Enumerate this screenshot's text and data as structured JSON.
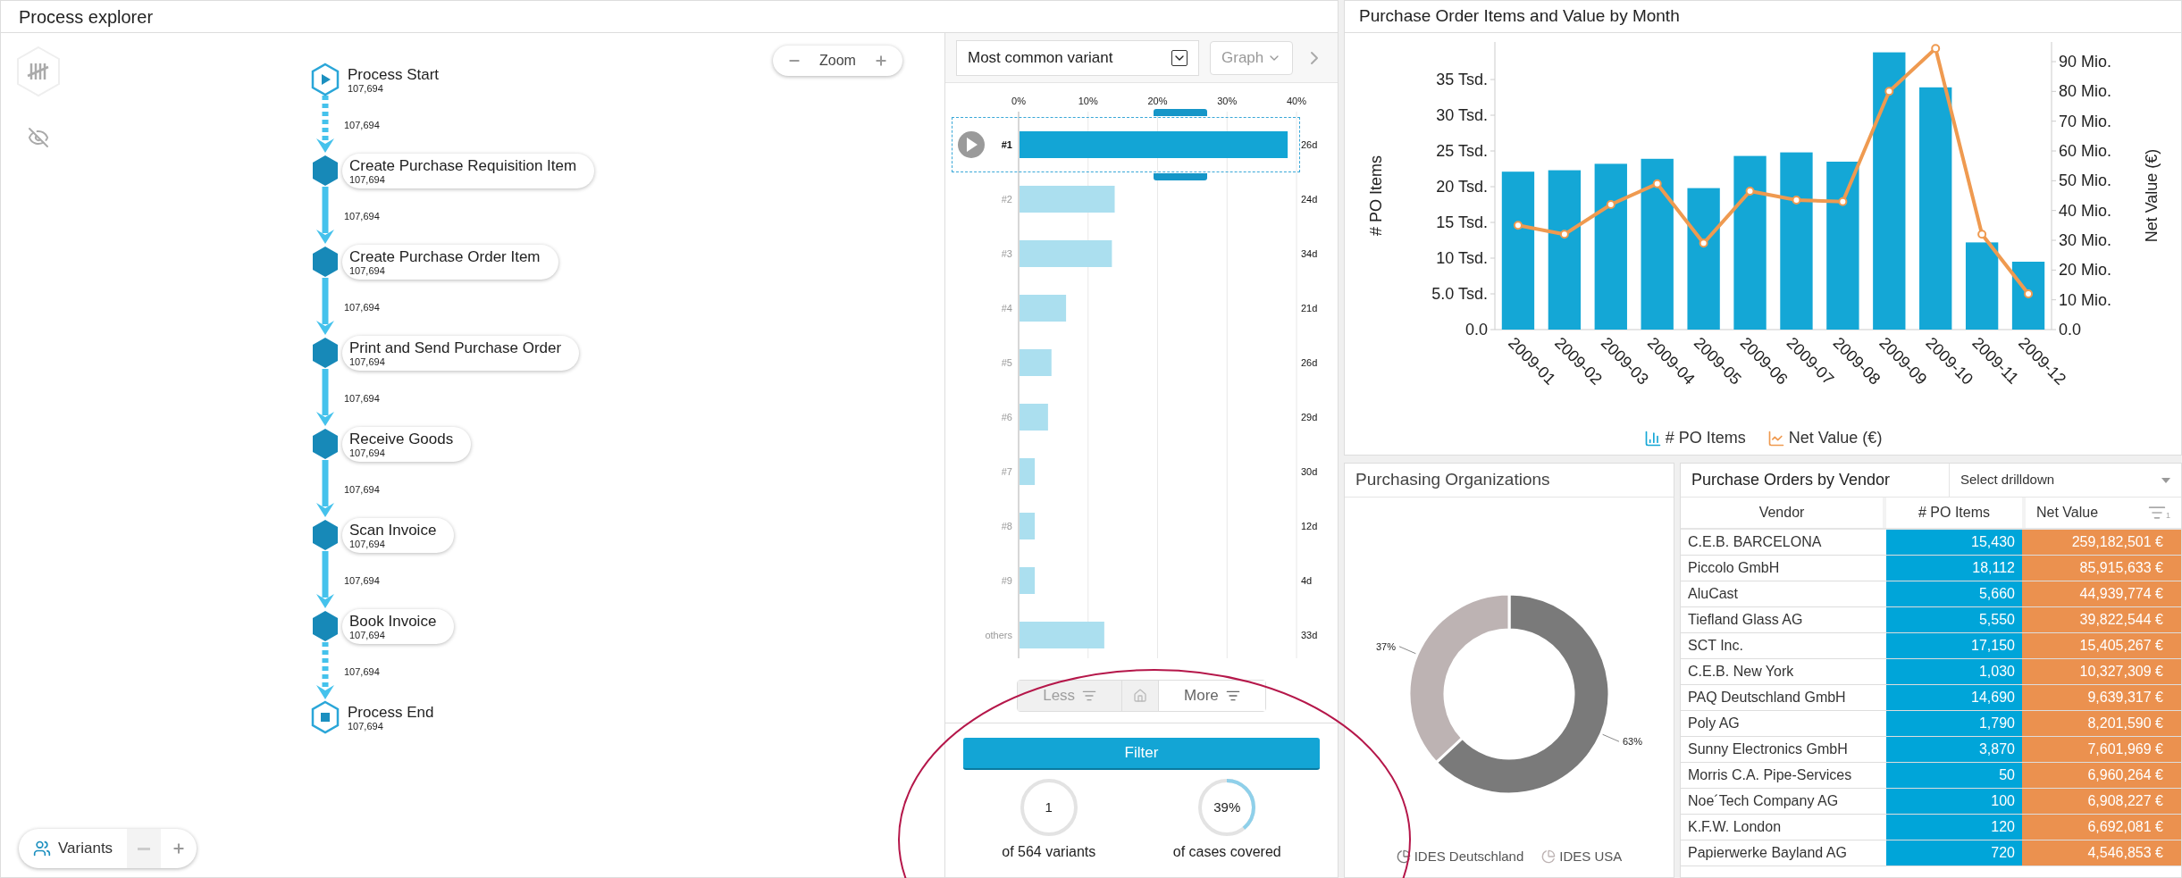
{
  "process_explorer": {
    "title": "Process explorer",
    "zoom": {
      "label": "Zoom"
    },
    "variants_control": {
      "label": "Variants"
    },
    "nodes": [
      {
        "kind": "start",
        "label": "Process Start",
        "count": "107,694"
      },
      {
        "kind": "activity",
        "label": "Create Purchase Requisition Item",
        "count": "107,694"
      },
      {
        "kind": "activity",
        "label": "Create Purchase Order Item",
        "count": "107,694"
      },
      {
        "kind": "activity",
        "label": "Print and Send Purchase Order",
        "count": "107,694"
      },
      {
        "kind": "activity",
        "label": "Receive Goods",
        "count": "107,694"
      },
      {
        "kind": "activity",
        "label": "Scan Invoice",
        "count": "107,694"
      },
      {
        "kind": "activity",
        "label": "Book Invoice",
        "count": "107,694"
      },
      {
        "kind": "end",
        "label": "Process End",
        "count": "107,694"
      }
    ],
    "edges": [
      {
        "count": "107,694",
        "dashed": true
      },
      {
        "count": "107,694",
        "dashed": false
      },
      {
        "count": "107,694",
        "dashed": false
      },
      {
        "count": "107,694",
        "dashed": false
      },
      {
        "count": "107,694",
        "dashed": false
      },
      {
        "count": "107,694",
        "dashed": false
      },
      {
        "count": "107,694",
        "dashed": true
      }
    ],
    "variant_panel": {
      "selector": "Most common variant",
      "view_button": "Graph",
      "chart_data": {
        "type": "bar",
        "orientation": "horizontal",
        "grid": true,
        "categories": [
          "#1",
          "#2",
          "#3",
          "#4",
          "#5",
          "#6",
          "#7",
          "#8",
          "#9",
          "others"
        ],
        "values": [
          38.6,
          13.7,
          13.3,
          6.7,
          4.6,
          4.1,
          2.2,
          2.2,
          2.2,
          12.2
        ],
        "xlim": [
          0,
          40
        ],
        "xticks": [
          {
            "value": 0,
            "label": "0%"
          },
          {
            "value": 10,
            "label": "10%"
          },
          {
            "value": 20,
            "label": "20%"
          },
          {
            "value": 30,
            "label": "30%"
          },
          {
            "value": 40,
            "label": "40%"
          }
        ]
      },
      "bars": [
        {
          "duration": "26d",
          "selected": true
        },
        {
          "duration": "24d",
          "selected": false
        },
        {
          "duration": "34d",
          "selected": false
        },
        {
          "duration": "21d",
          "selected": false
        },
        {
          "duration": "26d",
          "selected": false
        },
        {
          "duration": "29d",
          "selected": false
        },
        {
          "duration": "30d",
          "selected": false
        },
        {
          "duration": "12d",
          "selected": false
        },
        {
          "duration": "4d",
          "selected": false
        },
        {
          "duration": "33d",
          "selected": false
        }
      ],
      "less_button": {
        "label": "Less",
        "disabled": true
      },
      "more_button": {
        "label": "More",
        "disabled": false
      },
      "filter_button": "Filter",
      "stats": [
        {
          "value": "1",
          "caption": "of 564 variants",
          "level": 0
        },
        {
          "value": "39%",
          "caption": "of cases covered",
          "level": 0.39
        }
      ]
    }
  },
  "monthly_chart": {
    "title": "Purchase Order Items and Value by Month",
    "chart_data": {
      "type": "bar",
      "categories": [
        "2009-01",
        "2009-02",
        "2009-03",
        "2009-04",
        "2009-05",
        "2009-06",
        "2009-07",
        "2009-08",
        "2009-09",
        "2009-10",
        "2009-11",
        "2009-12"
      ],
      "series": [
        {
          "name": "# PO Items",
          "color": "#14a7d6",
          "type": "bar",
          "values": [
            22.1,
            22.3,
            23.2,
            23.9,
            19.8,
            24.3,
            24.8,
            23.5,
            38.8,
            33.9,
            12.2,
            9.5
          ]
        },
        {
          "name": "Net Value (€)",
          "color": "#ef9a50",
          "type": "line",
          "axis": "y2",
          "marker": "circle",
          "values": [
            35,
            32,
            42,
            49,
            29,
            46.5,
            43.5,
            43,
            80,
            94.4,
            32,
            12
          ]
        }
      ],
      "ylabel": "# PO Items",
      "y2label": "Net Value (€)",
      "ylim": [
        0,
        40
      ],
      "y2lim": [
        0,
        96
      ],
      "legend": true,
      "yticks": [
        {
          "value": 0,
          "label": "0.0"
        },
        {
          "value": 5,
          "label": "5.0 Tsd."
        },
        {
          "value": 10,
          "label": "10 Tsd."
        },
        {
          "value": 15,
          "label": "15 Tsd."
        },
        {
          "value": 20,
          "label": "20 Tsd."
        },
        {
          "value": 25,
          "label": "25 Tsd."
        },
        {
          "value": 30,
          "label": "30 Tsd."
        },
        {
          "value": 35,
          "label": "35 Tsd."
        }
      ],
      "y2ticks": [
        {
          "value": 0,
          "label": "0.0"
        },
        {
          "value": 10,
          "label": "10 Mio."
        },
        {
          "value": 20,
          "label": "20 Mio."
        },
        {
          "value": 30,
          "label": "30 Mio."
        },
        {
          "value": 40,
          "label": "40 Mio."
        },
        {
          "value": 50,
          "label": "50 Mio."
        },
        {
          "value": 60,
          "label": "60 Mio."
        },
        {
          "value": 70,
          "label": "70 Mio."
        },
        {
          "value": 80,
          "label": "80 Mio."
        },
        {
          "value": 90,
          "label": "90 Mio."
        }
      ]
    }
  },
  "purchasing_orgs": {
    "title": "Purchasing Organizations",
    "chart_data": {
      "type": "donut",
      "categories": [
        "IDES Deutschland",
        "IDES USA"
      ],
      "values": [
        63,
        37
      ],
      "colors": [
        "#7a7a7a",
        "#bdb3b3"
      ],
      "value_labels": [
        "63%",
        "37%"
      ],
      "legend": true
    }
  },
  "vendor_table": {
    "title": "Purchase Orders by Vendor",
    "drilldown": {
      "placeholder": "Select drilldown"
    },
    "columns": [
      {
        "label": "Vendor",
        "sorted": false
      },
      {
        "label": "# PO Items",
        "sorted": false
      },
      {
        "label": "Net Value",
        "sorted": true,
        "sort_rank": "1"
      }
    ],
    "rows": [
      [
        "C.E.B. BARCELONA",
        "15,430",
        "259,182,501 €"
      ],
      [
        "Piccolo GmbH",
        "18,112",
        "85,915,633 €"
      ],
      [
        "AluCast",
        "5,660",
        "44,939,774 €"
      ],
      [
        "Tiefland Glass AG",
        "5,550",
        "39,822,544 €"
      ],
      [
        "SCT Inc.",
        "17,150",
        "15,405,267 €"
      ],
      [
        "C.E.B. New York",
        "1,030",
        "10,327,309 €"
      ],
      [
        "PAQ Deutschland GmbH",
        "14,690",
        "9,639,317 €"
      ],
      [
        "Poly AG",
        "1,790",
        "8,201,590 €"
      ],
      [
        "Sunny Electronics GmbH",
        "3,870",
        "7,601,969 €"
      ],
      [
        "Morris C.A. Pipe-Services",
        "50",
        "6,960,264 €"
      ],
      [
        "Noe´Tech Company AG",
        "100",
        "6,908,227 €"
      ],
      [
        "K.F.W. London",
        "120",
        "6,692,081 €"
      ],
      [
        "Papierwerke Bayland AG",
        "720",
        "4,546,853 €"
      ]
    ]
  }
}
